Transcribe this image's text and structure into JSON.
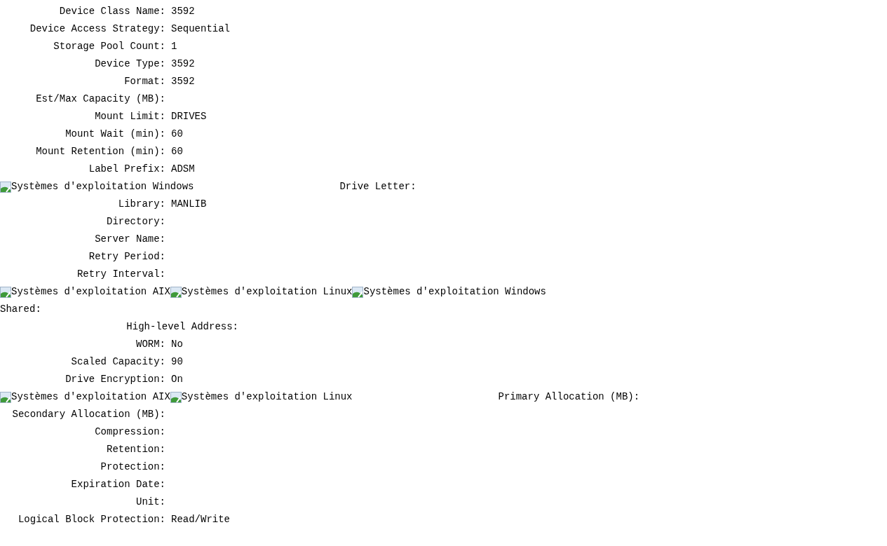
{
  "rows": [
    {
      "kind": "field",
      "label": "Device Class Name:",
      "value": "3592"
    },
    {
      "kind": "field",
      "label": "Device Access Strategy:",
      "value": "Sequential"
    },
    {
      "kind": "field",
      "label": "Storage Pool Count:",
      "value": "1"
    },
    {
      "kind": "field",
      "label": "Device Type:",
      "value": "3592"
    },
    {
      "kind": "field",
      "label": "Format:",
      "value": "3592"
    },
    {
      "kind": "field",
      "label": "Est/Max Capacity (MB):"
    },
    {
      "kind": "field",
      "label": "Mount Limit:",
      "value": "DRIVES"
    },
    {
      "kind": "field",
      "label": "Mount Wait (min):",
      "value": "60"
    },
    {
      "kind": "field",
      "label": "Mount Retention (min):",
      "value": "60"
    },
    {
      "kind": "field",
      "label": "Label Prefix:",
      "value": "ADSM"
    },
    {
      "kind": "os",
      "systems": [
        "Systèmes d'exploitation Windows"
      ],
      "field": {
        "label": "Drive Letter:"
      }
    },
    {
      "kind": "field",
      "label": "Library:",
      "value": "MANLIB"
    },
    {
      "kind": "field",
      "label": "Directory:"
    },
    {
      "kind": "field",
      "label": "Server Name:"
    },
    {
      "kind": "field",
      "label": "Retry Period:"
    },
    {
      "kind": "field",
      "label": "Retry Interval:"
    },
    {
      "kind": "os",
      "systems": [
        "Systèmes d'exploitation AIX",
        "Systèmes d'exploitation Linux",
        "Systèmes d'exploitation Windows"
      ]
    },
    {
      "kind": "plain",
      "label": "Shared:"
    },
    {
      "kind": "field_deep",
      "label": "High-level Address:"
    },
    {
      "kind": "field",
      "label": "WORM:",
      "value": "No"
    },
    {
      "kind": "field",
      "label": "Scaled Capacity:",
      "value": "90"
    },
    {
      "kind": "field",
      "label": "Drive Encryption:",
      "value": "On"
    },
    {
      "kind": "os",
      "systems": [
        "Systèmes d'exploitation AIX",
        "Systèmes d'exploitation Linux"
      ],
      "field": {
        "label": "Primary Allocation (MB):"
      }
    },
    {
      "kind": "field",
      "label": "Secondary Allocation (MB):"
    },
    {
      "kind": "field",
      "label": "Compression:"
    },
    {
      "kind": "field",
      "label": "Retention:"
    },
    {
      "kind": "field",
      "label": "Protection:"
    },
    {
      "kind": "field",
      "label": "Expiration Date:"
    },
    {
      "kind": "field",
      "label": "Unit:"
    },
    {
      "kind": "field",
      "label": "Logical Block Protection:",
      "value": "Read/Write"
    }
  ]
}
